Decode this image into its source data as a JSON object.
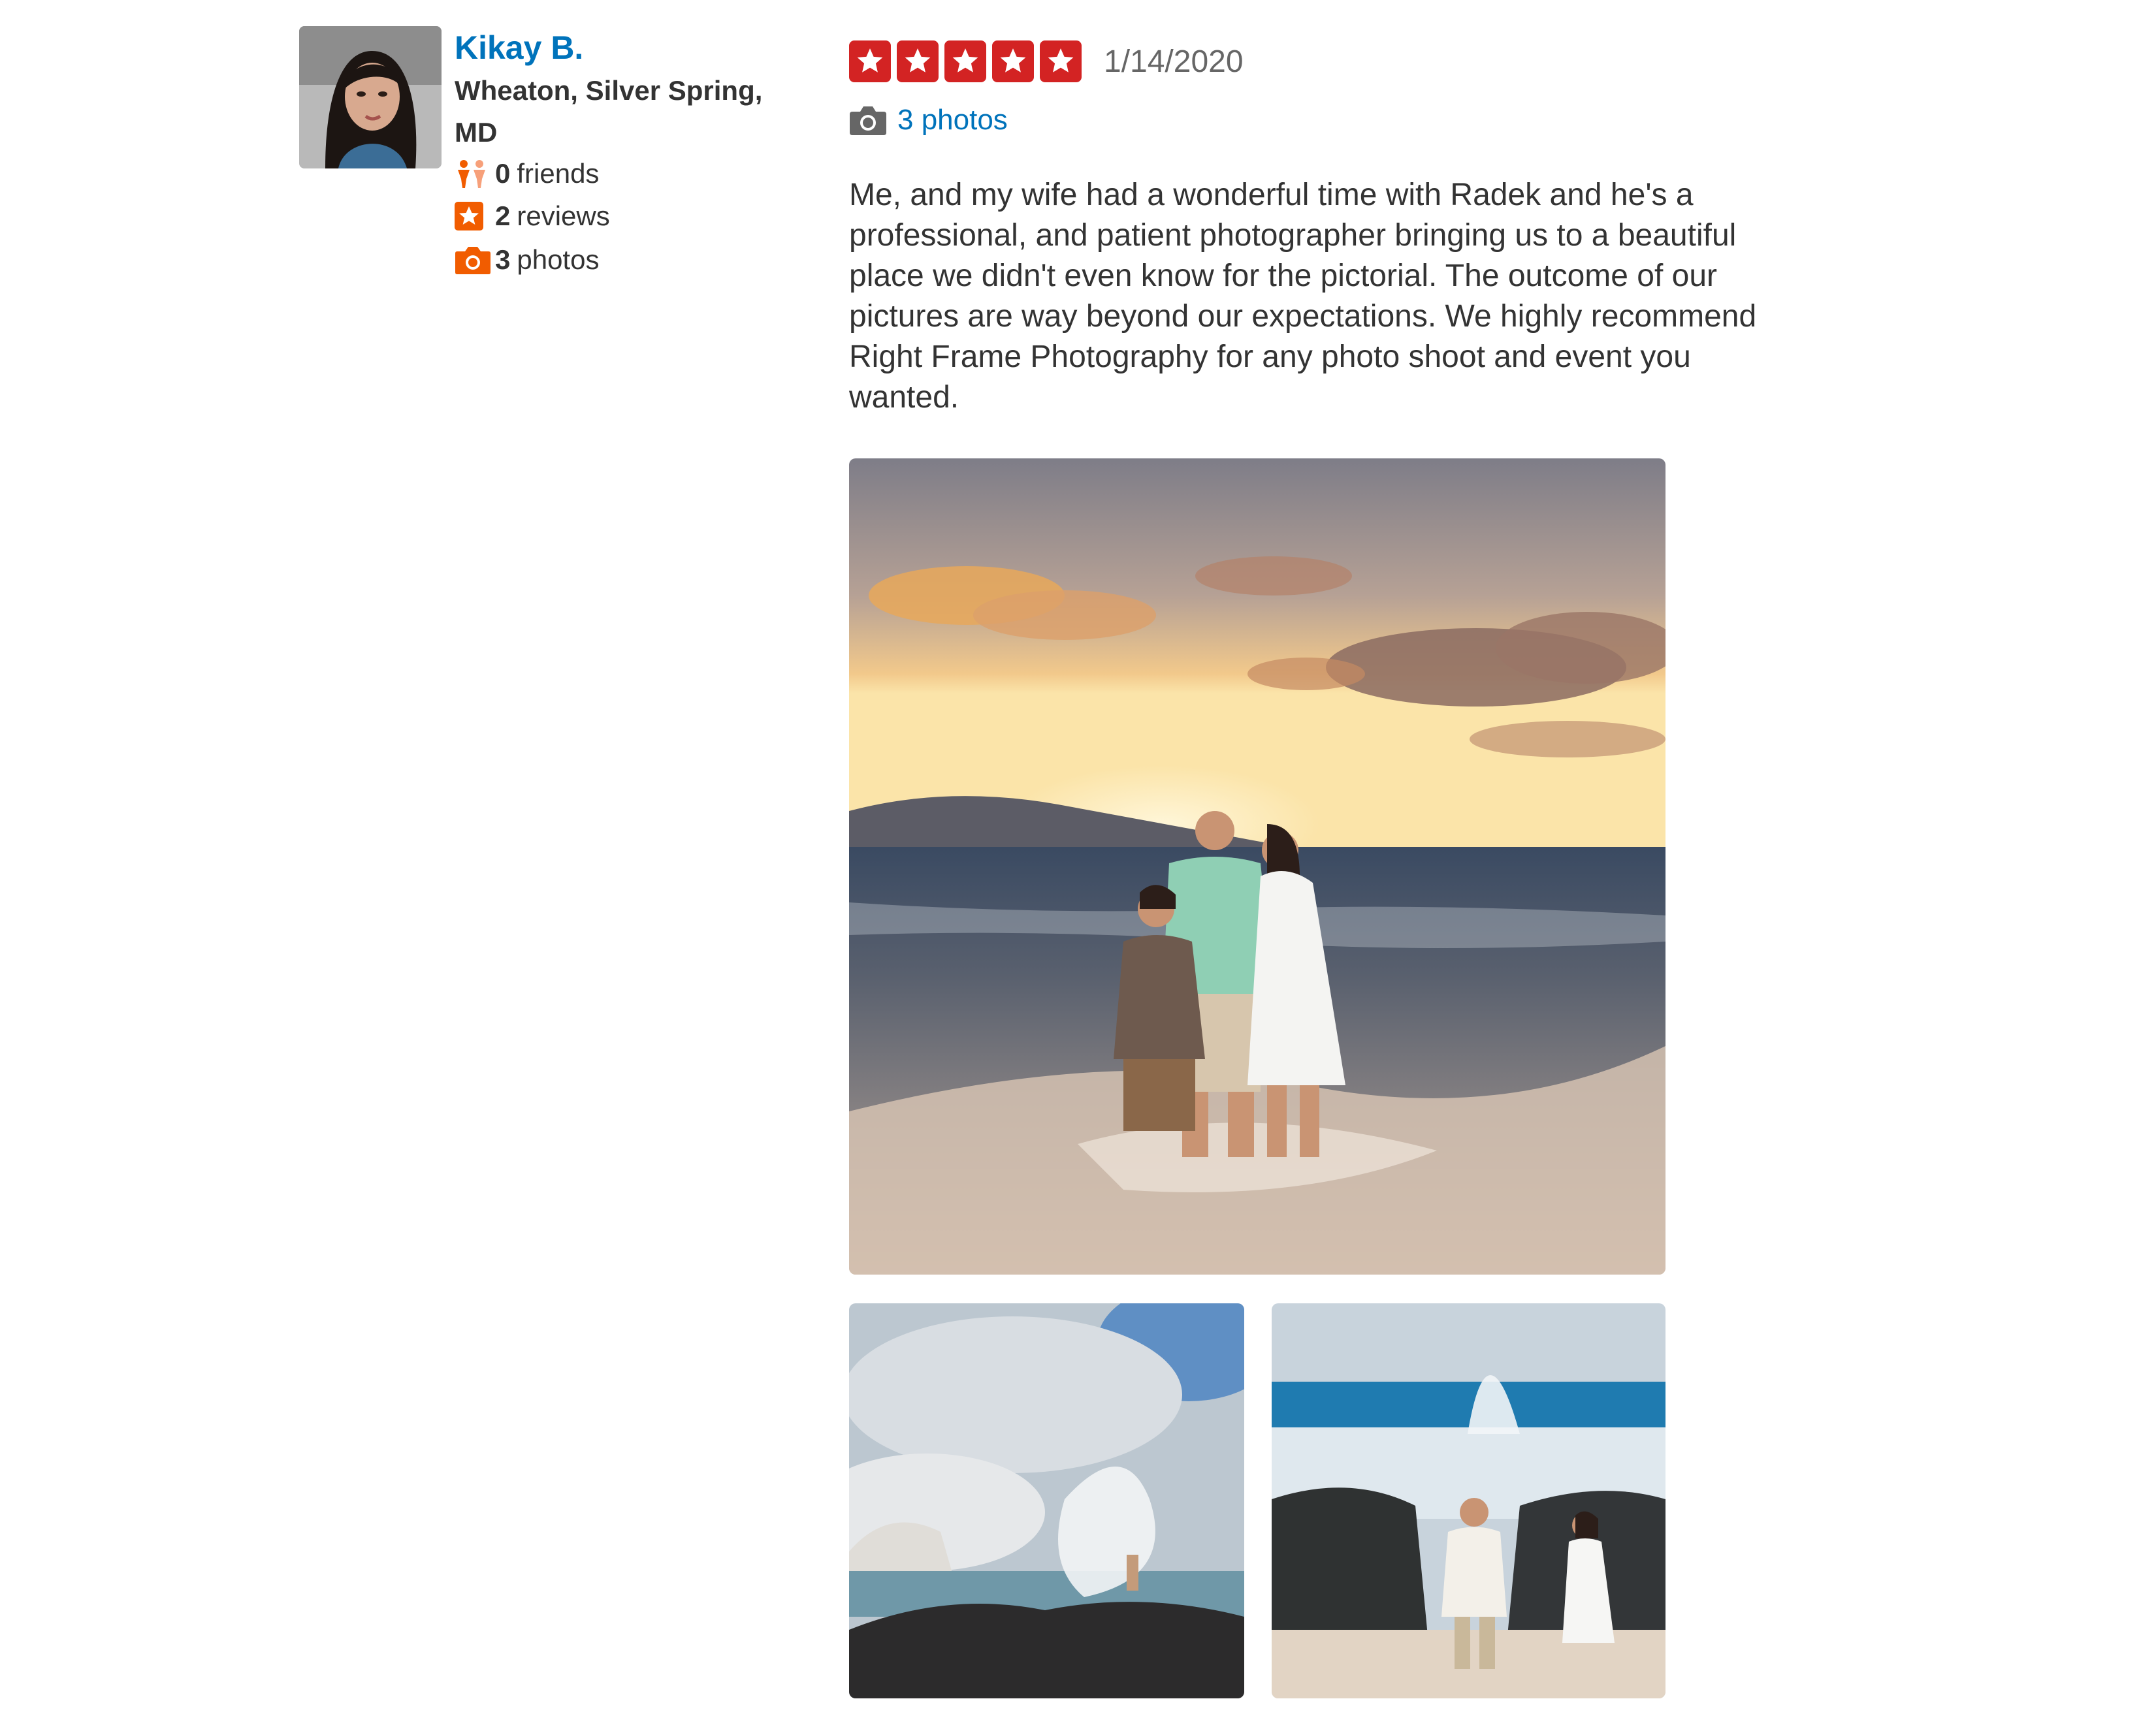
{
  "user": {
    "name": "Kikay B.",
    "location": "Wheaton, Silver Spring, MD",
    "stats": {
      "friends": {
        "count": "0",
        "label": "friends",
        "icon": "friends-icon"
      },
      "reviews": {
        "count": "2",
        "label": "reviews",
        "icon": "review-star-icon"
      },
      "photos": {
        "count": "3",
        "label": "photos",
        "icon": "camera-icon"
      }
    }
  },
  "review": {
    "rating": 5,
    "rating_max": 5,
    "date": "1/14/2020",
    "photos_link": "3 photos",
    "text": "Me, and my wife had a wonderful time with Radek and he's a professional, and patient photographer bringing us to a beautiful place we didn't even know for the pictorial. The outcome of our pictures are way beyond our expectations. We highly recommend Right Frame Photography for any photo shoot and event you wanted."
  },
  "colors": {
    "link": "#0073bb",
    "star": "#d32323",
    "stat_icon": "#f15c00",
    "text": "#333333",
    "muted": "#666666"
  }
}
